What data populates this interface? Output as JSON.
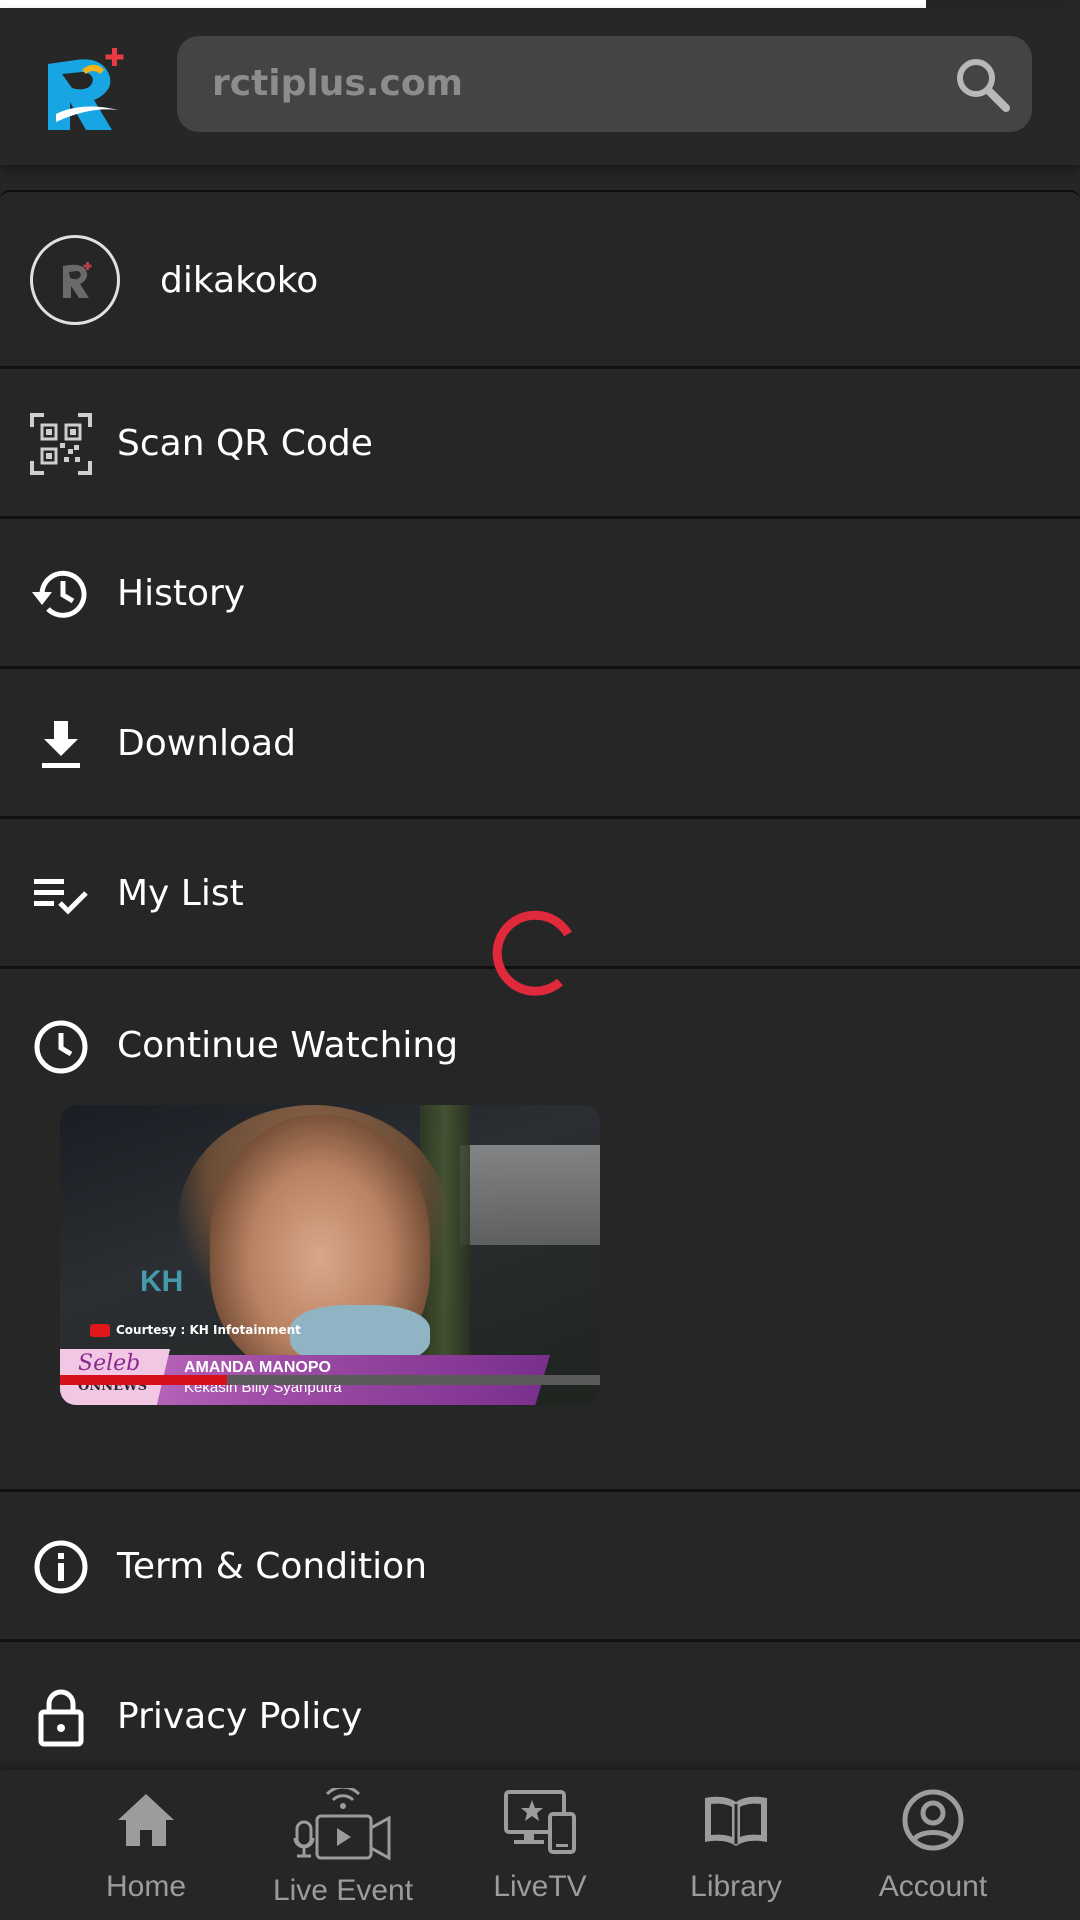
{
  "page_load_progress": 0.857,
  "header": {
    "logo_icon": "rctiplus-logo-icon",
    "search": {
      "placeholder": "rctiplus.com",
      "icon": "search-icon"
    }
  },
  "profile": {
    "username": "dikakoko",
    "avatar_icon": "rctiplus-avatar-icon"
  },
  "menu": {
    "items": [
      {
        "label": "Scan QR Code",
        "icon": "qr-code-icon"
      },
      {
        "label": "History",
        "icon": "history-icon"
      },
      {
        "label": "Download",
        "icon": "download-icon"
      },
      {
        "label": "My List",
        "icon": "playlist-check-icon"
      }
    ],
    "continue_watching": {
      "label": "Continue Watching",
      "icon": "clock-icon",
      "video": {
        "courtesy": "Courtesy : KH Infotainment",
        "show_logo": "Seleb",
        "show_logo_sub": "ONNEWS",
        "title": "AMANDA MANOPO",
        "subtitle": "Kekasih Billy Syahputra",
        "watermark": "KH",
        "progress": 0.31
      }
    },
    "footer_items": [
      {
        "label": "Term & Condition",
        "icon": "info-icon"
      },
      {
        "label": "Privacy Policy",
        "icon": "lock-icon"
      }
    ]
  },
  "loading_spinner": {
    "color": "#e0293b"
  },
  "bottom_nav": {
    "items": [
      {
        "label": "Home",
        "icon": "home-icon"
      },
      {
        "label": "Live Event",
        "icon": "live-event-icon"
      },
      {
        "label": "LiveTV",
        "icon": "live-tv-icon"
      },
      {
        "label": "Library",
        "icon": "library-icon"
      },
      {
        "label": "Account",
        "icon": "account-icon"
      }
    ]
  },
  "colors": {
    "background": "#262626",
    "accent_red": "#d4111c",
    "logo_blue": "#17a6e3",
    "nav_inactive": "#9c9c9c"
  }
}
